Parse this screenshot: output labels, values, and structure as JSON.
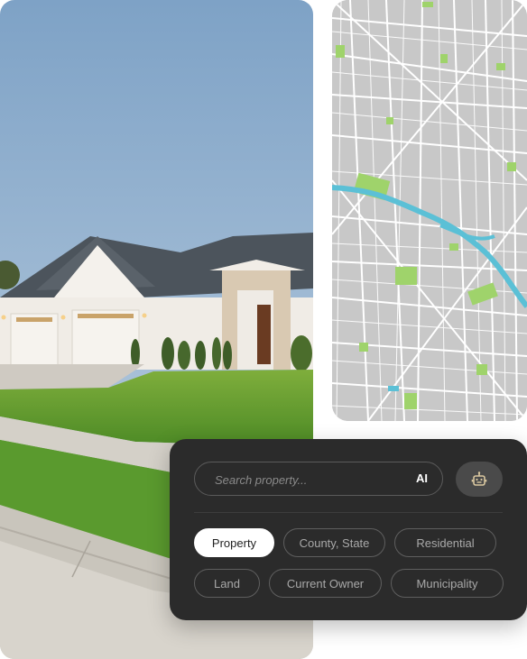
{
  "search": {
    "placeholder": "Search property...",
    "ai_label": "AI"
  },
  "filters": [
    {
      "label": "Property",
      "active": true
    },
    {
      "label": "County, State",
      "active": false
    },
    {
      "label": "Residential",
      "active": false
    },
    {
      "label": "Land",
      "active": false
    },
    {
      "label": "Current Owner",
      "active": false
    },
    {
      "label": "Municipality",
      "active": false
    }
  ],
  "colors": {
    "panel_bg": "#2b2b2b",
    "chip_active_bg": "#ffffff",
    "map_water": "#5bc0d6",
    "map_park": "#9fd36b",
    "robot_icon": "#d9c7a0"
  },
  "icons": {
    "robot": "robot-icon"
  }
}
